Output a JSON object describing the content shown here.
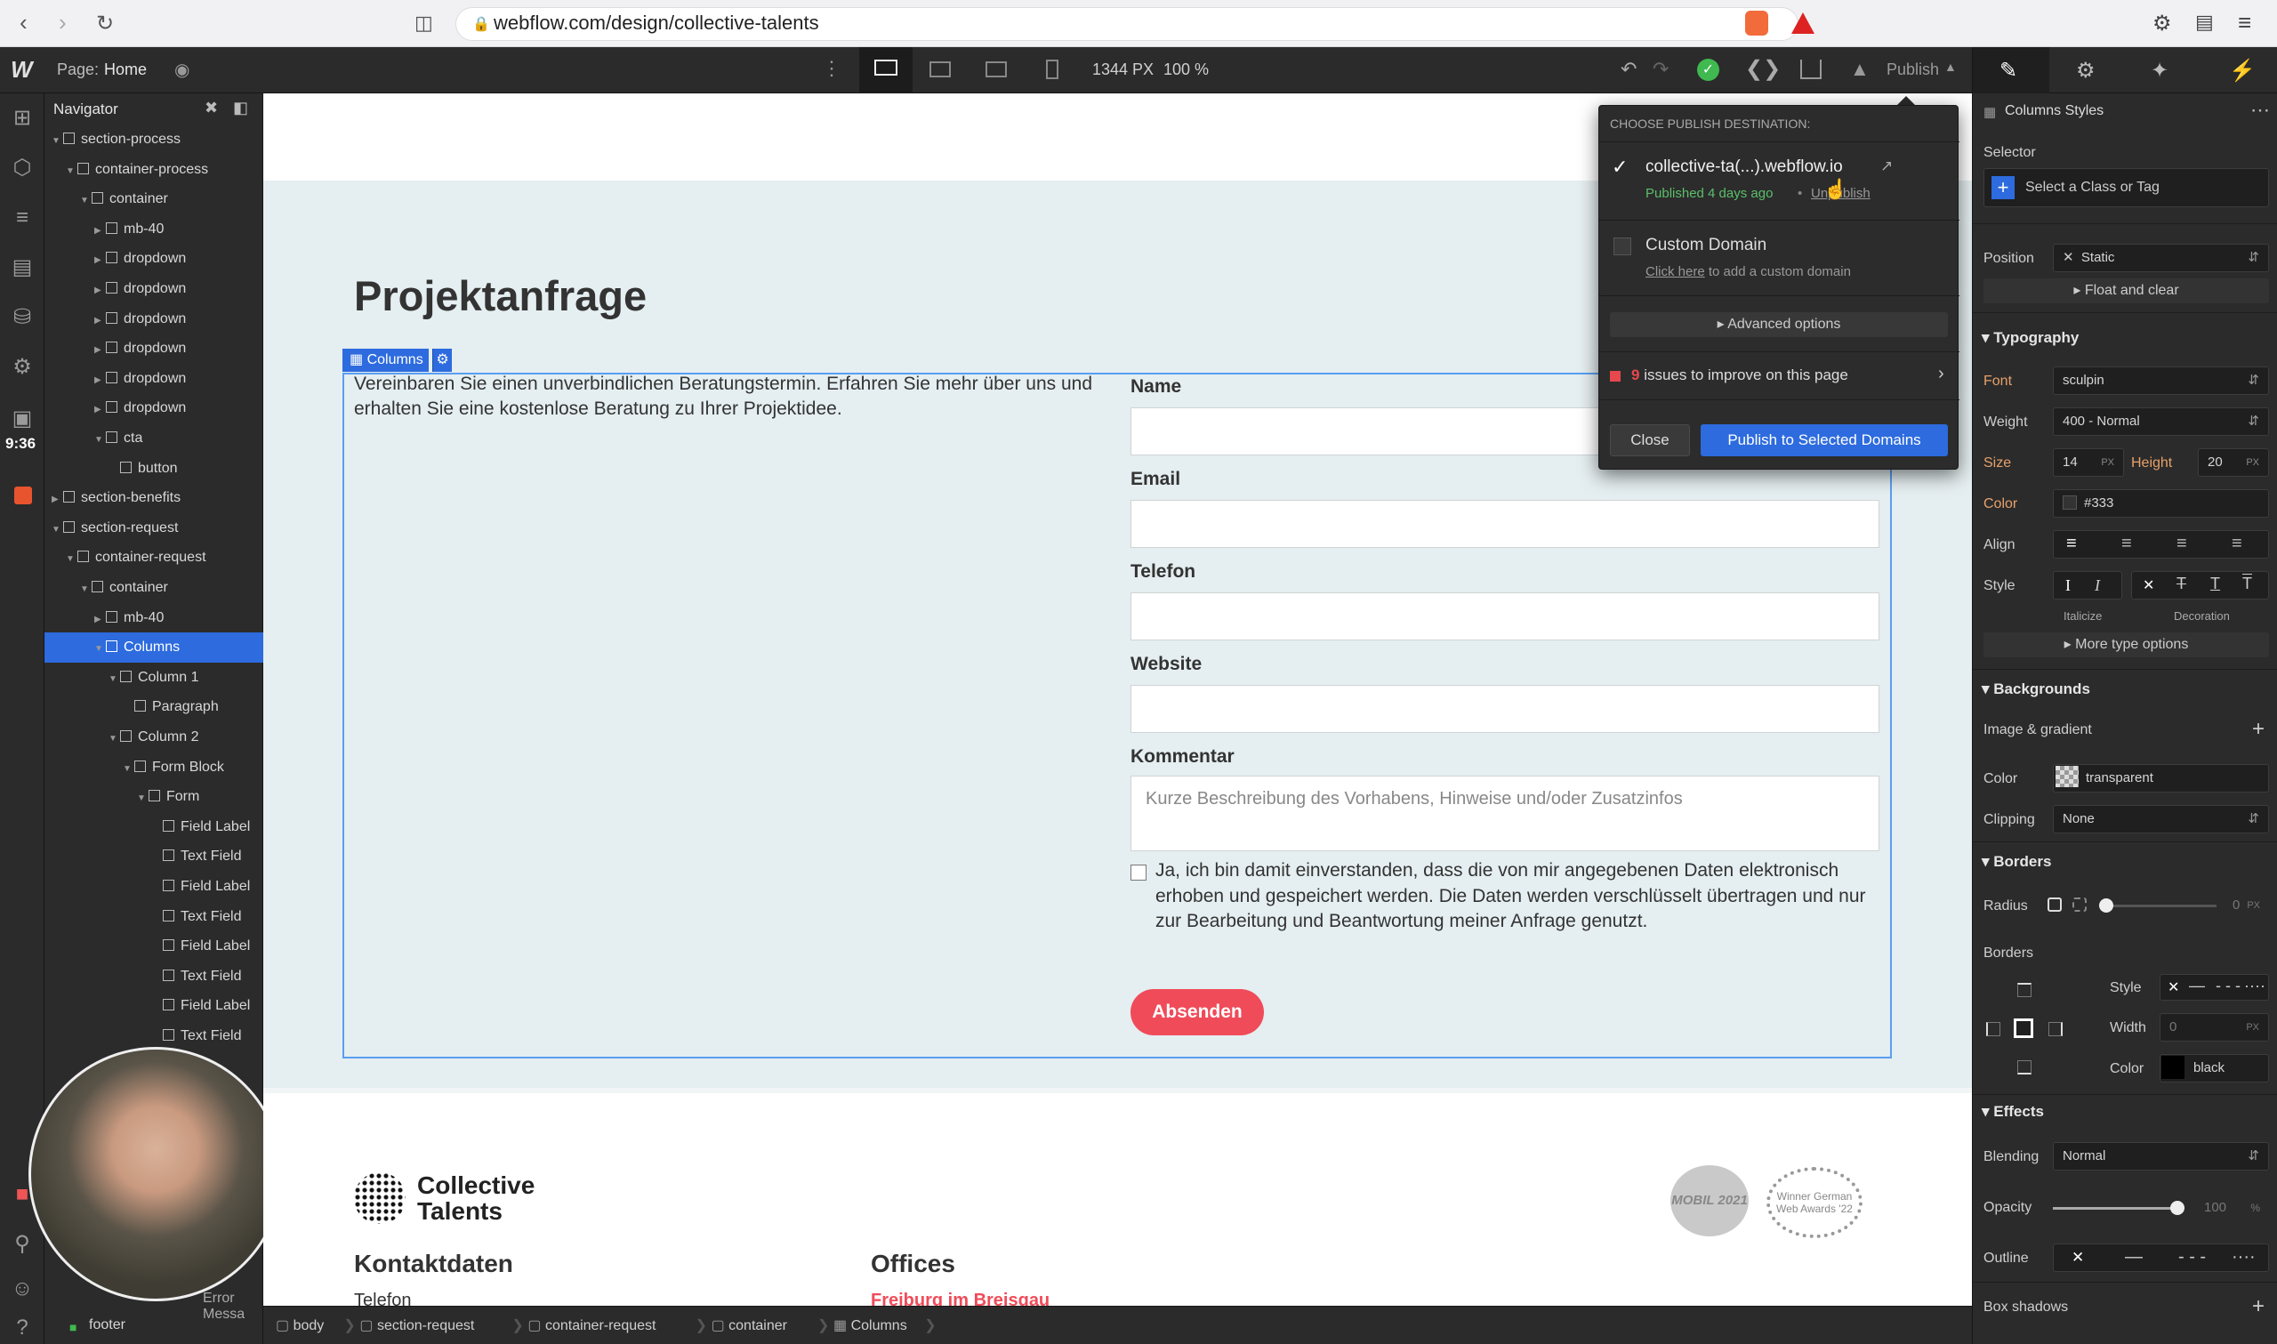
{
  "browser": {
    "url": "webflow.com/design/collective-talents"
  },
  "topbar": {
    "page_prefix": "Page:",
    "page_name": "Home",
    "width_label": "1344 PX",
    "zoom_label": "100 %",
    "publish_label": "Publish"
  },
  "navigator": {
    "title": "Navigator",
    "items": [
      {
        "label": "section-process",
        "depth": 0,
        "open": true
      },
      {
        "label": "container-process",
        "depth": 1,
        "open": true
      },
      {
        "label": "container",
        "depth": 2,
        "open": true
      },
      {
        "label": "mb-40",
        "depth": 3,
        "open": false
      },
      {
        "label": "dropdown",
        "depth": 3,
        "open": false
      },
      {
        "label": "dropdown",
        "depth": 3,
        "open": false
      },
      {
        "label": "dropdown",
        "depth": 3,
        "open": false
      },
      {
        "label": "dropdown",
        "depth": 3,
        "open": false
      },
      {
        "label": "dropdown",
        "depth": 3,
        "open": false
      },
      {
        "label": "dropdown",
        "depth": 3,
        "open": false
      },
      {
        "label": "cta",
        "depth": 3,
        "open": true
      },
      {
        "label": "button",
        "depth": 4,
        "open": null
      },
      {
        "label": "section-benefits",
        "depth": 0,
        "open": false
      },
      {
        "label": "section-request",
        "depth": 0,
        "open": true
      },
      {
        "label": "container-request",
        "depth": 1,
        "open": true
      },
      {
        "label": "container",
        "depth": 2,
        "open": true
      },
      {
        "label": "mb-40",
        "depth": 3,
        "open": false
      },
      {
        "label": "Columns",
        "depth": 3,
        "open": true
      },
      {
        "label": "Column 1",
        "depth": 4,
        "open": true
      },
      {
        "label": "Paragraph",
        "depth": 5,
        "open": null
      },
      {
        "label": "Column 2",
        "depth": 4,
        "open": true
      },
      {
        "label": "Form Block",
        "depth": 5,
        "open": true
      },
      {
        "label": "Form",
        "depth": 6,
        "open": true
      },
      {
        "label": "Field Label",
        "depth": 7,
        "open": null
      },
      {
        "label": "Text Field",
        "depth": 7,
        "open": null
      },
      {
        "label": "Field Label",
        "depth": 7,
        "open": null
      },
      {
        "label": "Text Field",
        "depth": 7,
        "open": null
      },
      {
        "label": "Field Label",
        "depth": 7,
        "open": null
      },
      {
        "label": "Text Field",
        "depth": 7,
        "open": null
      },
      {
        "label": "Field Label",
        "depth": 7,
        "open": null
      },
      {
        "label": "Text Field",
        "depth": 7,
        "open": null
      }
    ],
    "selected_index": 17,
    "bottom_item": "footer",
    "partial_a": "Me",
    "partial_b": "Error Messa",
    "time": "9:36"
  },
  "canvas": {
    "heading": "Projektanfrage",
    "columns_tag": "Columns",
    "intro": "Vereinbaren Sie einen unverbindlichen Beratungstermin. Erfahren Sie mehr über uns und erhalten Sie eine kostenlose Beratung zu Ihrer Projektidee.",
    "fields": [
      "Name",
      "Email",
      "Telefon",
      "Website",
      "Kommentar"
    ],
    "comment_placeholder": "Kurze Beschreibung des Vorhabens, Hinweise und/oder Zusatzinfos",
    "consent": "Ja, ich bin damit einverstanden, dass die von mir angegebenen Daten elektronisch erhoben und gespeichert werden. Die Daten werden verschlüsselt übertragen und nur zur Bearbeitung und Beantwortung meiner Anfrage genutzt.",
    "submit": "Absenden",
    "logo_line1": "Collective",
    "logo_line2": "Talents",
    "kontakt": "Kontaktdaten",
    "offices": "Offices",
    "telefon_label": "Telefon",
    "city": "Freiburg im Breisgau",
    "award1": "MOBIL 2021",
    "award2": "Winner German Web Awards '22"
  },
  "publish": {
    "header": "CHOOSE PUBLISH DESTINATION:",
    "domain1": "collective-ta(...).webflow.io",
    "published": "Published 4 days ago",
    "unpublish": "Unpublish",
    "domain2": "Custom Domain",
    "click_here": "Click here",
    "add_custom": " to add a custom domain",
    "advanced": "Advanced options",
    "issues_count": "9",
    "issues_text": " issues to improve on this page",
    "close": "Close",
    "publish_btn": "Publish to Selected Domains"
  },
  "styles": {
    "title": "Columns Styles",
    "selector_label": "Selector",
    "selector_placeholder": "Select a Class or Tag",
    "position_label": "Position",
    "position_value": "Static",
    "float_clear": "Float and clear",
    "typography": "Typography",
    "font_label": "Font",
    "font_value": "sculpin",
    "weight_label": "Weight",
    "weight_value": "400 - Normal",
    "size_label": "Size",
    "size_value": "14",
    "size_unit": "PX",
    "height_label": "Height",
    "height_value": "20",
    "height_unit": "PX",
    "color_label": "Color",
    "color_value": "#333",
    "align_label": "Align",
    "style_label": "Style",
    "italicize": "Italicize",
    "decoration": "Decoration",
    "more_type": "More type options",
    "backgrounds": "Backgrounds",
    "image_gradient": "Image & gradient",
    "bg_color_label": "Color",
    "bg_color_value": "transparent",
    "clipping_label": "Clipping",
    "clipping_value": "None",
    "borders": "Borders",
    "radius_label": "Radius",
    "radius_value": "0",
    "radius_unit": "PX",
    "borders_sub": "Borders",
    "b_style_label": "Style",
    "b_width_label": "Width",
    "b_width_value": "0",
    "b_width_unit": "PX",
    "b_color_label": "Color",
    "b_color_value": "black",
    "effects": "Effects",
    "blending_label": "Blending",
    "blending_value": "Normal",
    "opacity_label": "Opacity",
    "opacity_value": "100",
    "opacity_unit": "%",
    "opacity_level": 1.0,
    "outline_label": "Outline",
    "box_shadows": "Box shadows"
  },
  "breadcrumbs": [
    "body",
    "section-request",
    "container-request",
    "container",
    "Columns"
  ],
  "colors": {
    "accent": "#2d6bde",
    "submit": "#f04b59",
    "published": "#5bbf6a",
    "issue": "#e5484d"
  }
}
